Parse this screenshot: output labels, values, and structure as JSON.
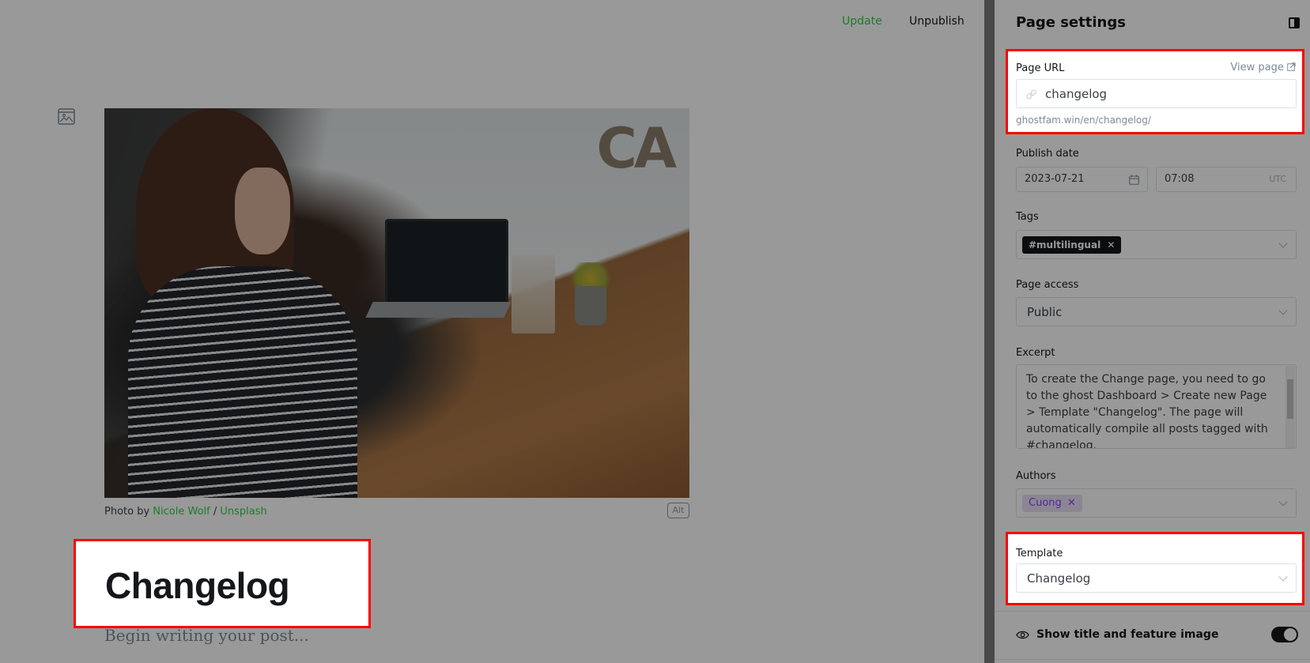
{
  "editor": {
    "update_label": "Update",
    "unpublish_label": "Unpublish",
    "image_caption": {
      "prefix": "Photo by ",
      "author": "Nicole Wolf",
      "separator": " / ",
      "source": "Unsplash"
    },
    "alt_label": "Alt",
    "title": "Changelog",
    "body_placeholder": "Begin writing your post..."
  },
  "sidebar": {
    "title": "Page settings",
    "page_url": {
      "label": "Page URL",
      "view_page_label": "View page",
      "value": "changelog",
      "hint": "ghostfam.win/en/changelog/"
    },
    "publish_date": {
      "label": "Publish date",
      "date": "2023-07-21",
      "time": "07:08",
      "timezone": "UTC"
    },
    "tags": {
      "label": "Tags",
      "items": [
        "#multilingual"
      ]
    },
    "page_access": {
      "label": "Page access",
      "value": "Public"
    },
    "excerpt": {
      "label": "Excerpt",
      "value": "To create the Change page, you need to go to the ghost Dashboard > Create new Page > Template \"Changelog\". The page will automatically compile all posts tagged with #changelog."
    },
    "authors": {
      "label": "Authors",
      "items": [
        "Cuong"
      ]
    },
    "template": {
      "label": "Template",
      "value": "Changelog"
    },
    "show_title_feature_image": {
      "label": "Show title and feature image",
      "enabled": true
    }
  },
  "colors": {
    "accent_green": "#30cf43",
    "highlight_red": "#ff0000",
    "author_purple": "#8e42ff"
  }
}
